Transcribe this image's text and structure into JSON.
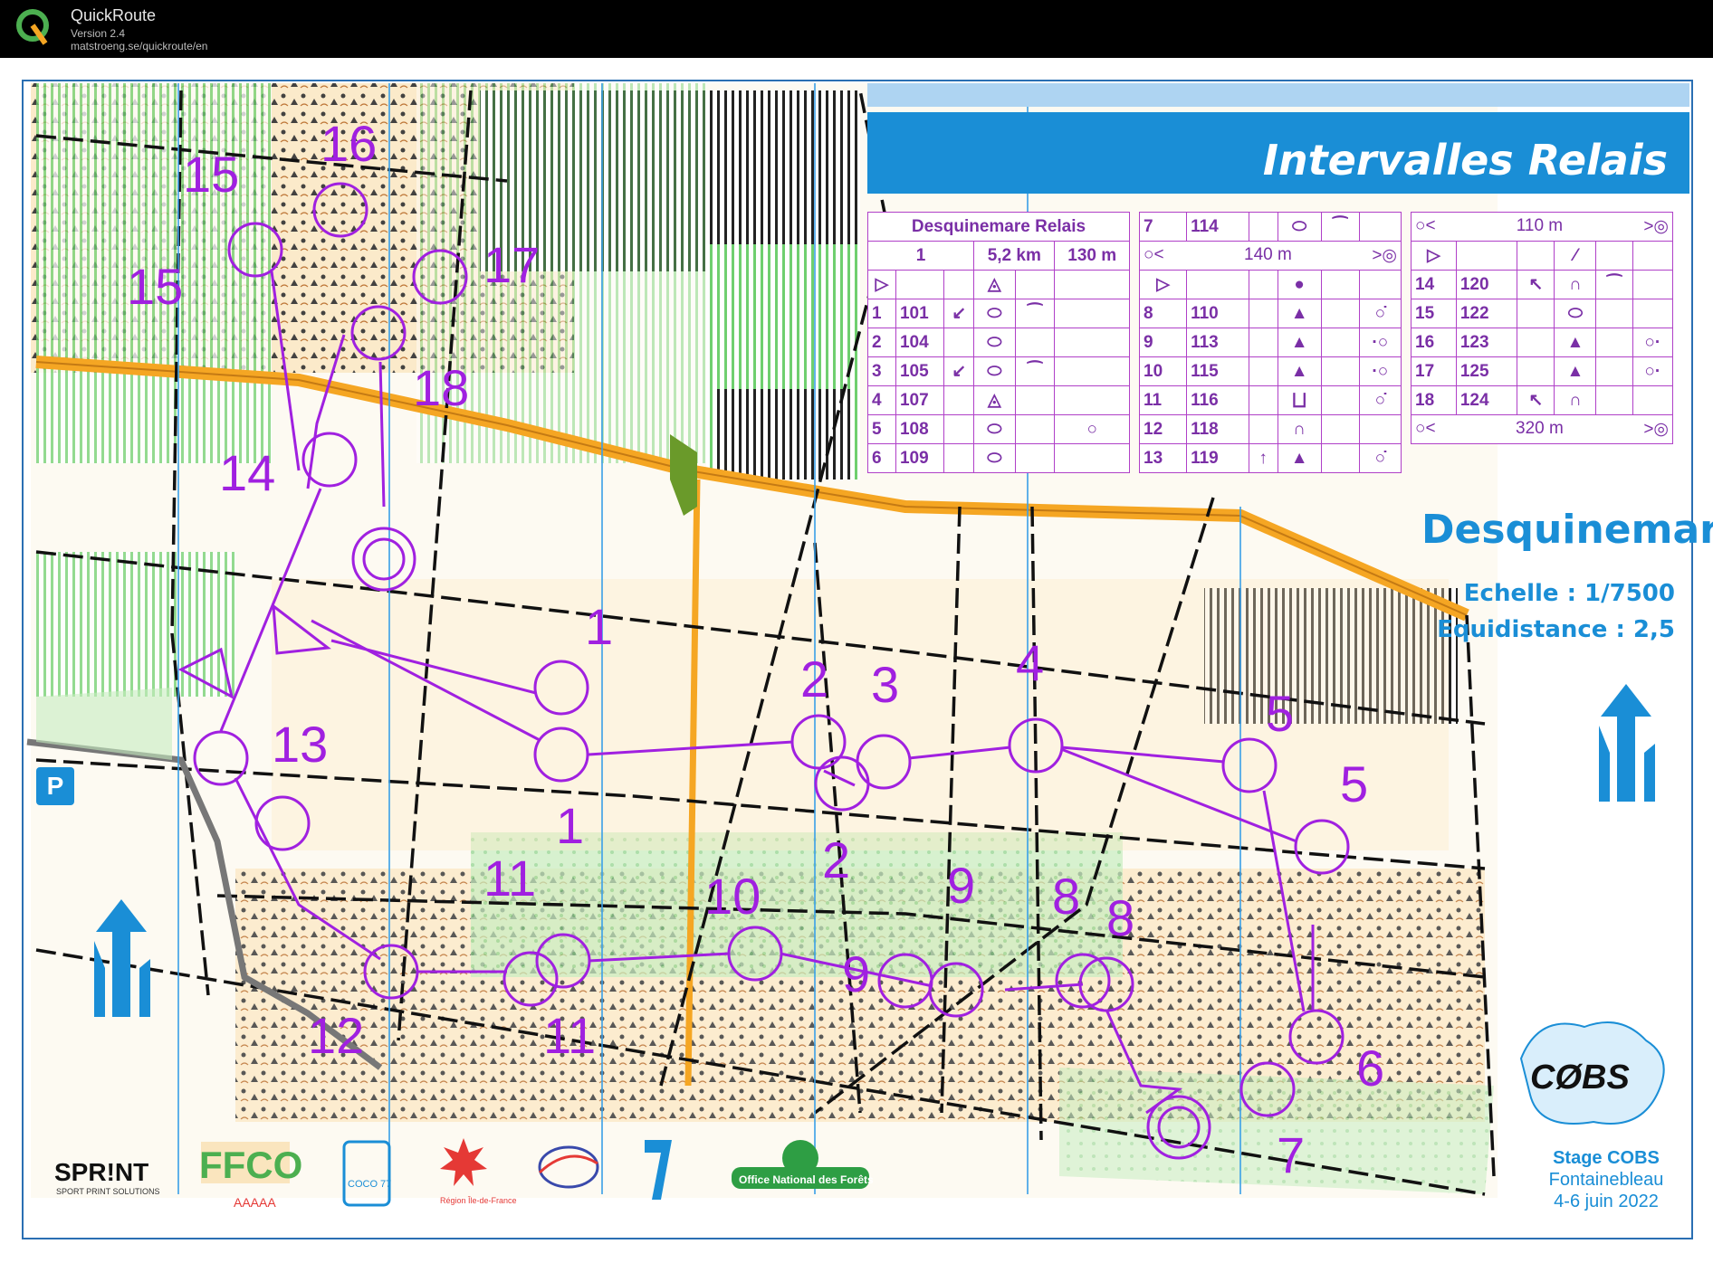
{
  "app": {
    "name": "QuickRoute",
    "version": "Version 2.4",
    "url": "matstroeng.se/quickroute/en"
  },
  "map": {
    "title": "Intervalles Relais",
    "area": "Desquinemare",
    "scale": "Echelle : 1/7500",
    "equidistance": "Equidistance : 2,5",
    "parking_label": "P",
    "stage_title": "Stage COBS",
    "stage_place": "Fontainebleau",
    "stage_dates": "4-6 juin 2022",
    "club_logo": "CØBS",
    "colors": {
      "course": "#a020e0",
      "brand": "#1a8ed6",
      "green": "#8bd28b",
      "orange": "#f5a623"
    }
  },
  "control_labels": [
    "1",
    "1",
    "2",
    "2",
    "3",
    "4",
    "5",
    "5",
    "6",
    "7",
    "8",
    "8",
    "9",
    "9",
    "10",
    "11",
    "11",
    "12",
    "13",
    "14",
    "15",
    "15",
    "16",
    "17",
    "18"
  ],
  "descriptions": {
    "header": {
      "event": "Desquinemare Relais",
      "course": "1",
      "length": "5,2 km",
      "climb": "130 m"
    },
    "table1": [
      {
        "num": "1",
        "code": "101",
        "dir": "↙",
        "feat": "⬭",
        "det": "⁀",
        "pos": ""
      },
      {
        "num": "2",
        "code": "104",
        "dir": "",
        "feat": "⬭",
        "det": "",
        "pos": ""
      },
      {
        "num": "3",
        "code": "105",
        "dir": "↙",
        "feat": "⬭",
        "det": "⁀",
        "pos": ""
      },
      {
        "num": "4",
        "code": "107",
        "dir": "",
        "feat": "◬",
        "det": "",
        "pos": ""
      },
      {
        "num": "5",
        "code": "108",
        "dir": "",
        "feat": "⬭",
        "det": "",
        "pos": "○"
      },
      {
        "num": "6",
        "code": "109",
        "dir": "",
        "feat": "⬭",
        "det": "",
        "pos": ""
      }
    ],
    "table2_first": {
      "num": "7",
      "code": "114",
      "feat": "⬭",
      "det": "⁀"
    },
    "table2_marked": "140 m",
    "table2": [
      {
        "num": "8",
        "code": "110",
        "feat": "▲",
        "pos": "○̇"
      },
      {
        "num": "9",
        "code": "113",
        "feat": "▲",
        "pos": "·○"
      },
      {
        "num": "10",
        "code": "115",
        "feat": "▲",
        "pos": "·○"
      },
      {
        "num": "11",
        "code": "116",
        "feat": "⨆",
        "pos": "○̇"
      },
      {
        "num": "12",
        "code": "118",
        "feat": "∩",
        "pos": ""
      },
      {
        "num": "13",
        "code": "119",
        "dir": "↑",
        "feat": "▲",
        "pos": "○̇"
      }
    ],
    "table3_marked1": "110 m",
    "table3": [
      {
        "num": "14",
        "code": "120",
        "dir": "↖",
        "feat": "∩",
        "det": "⁀",
        "pos": ""
      },
      {
        "num": "15",
        "code": "122",
        "dir": "",
        "feat": "⬭",
        "det": "",
        "pos": ""
      },
      {
        "num": "16",
        "code": "123",
        "dir": "",
        "feat": "▲",
        "det": "",
        "pos": "○·"
      },
      {
        "num": "17",
        "code": "125",
        "dir": "",
        "feat": "▲",
        "det": "",
        "pos": "○·"
      },
      {
        "num": "18",
        "code": "124",
        "dir": "↖",
        "feat": "∩",
        "det": "",
        "pos": ""
      }
    ],
    "table3_marked2": "320 m"
  },
  "sponsors": [
    "SPR!NT",
    "SPORT PRINT SOLUTIONS",
    "FFCO",
    "AAAAA",
    "COCO 77",
    "Région Île-de-France",
    "Office National des Forêts"
  ]
}
